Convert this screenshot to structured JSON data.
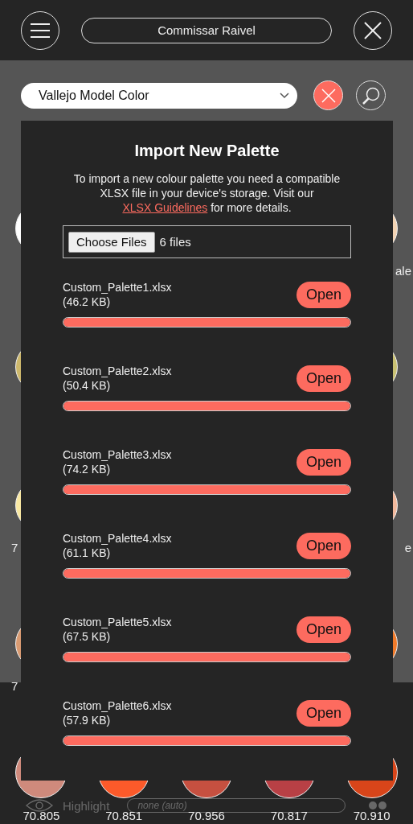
{
  "header": {
    "title": "Commissar Raivel"
  },
  "toolbar": {
    "palette": "Vallejo Model Color"
  },
  "swatch_rows": [
    {
      "left": {
        "color": "#ffffff"
      },
      "right": {
        "color": "#f3d3b3",
        "label": "ale"
      }
    },
    {
      "left": {
        "color": "#cdb86c"
      },
      "right": {
        "color": "#c9c173"
      }
    },
    {
      "left": {
        "color": "#f9e8a2",
        "label": "7"
      },
      "right": {
        "color": "#f1b89c",
        "label": "e"
      }
    },
    {
      "left": {
        "color": "#d99b72",
        "label": "7"
      },
      "right": {
        "color": "#f07a2a"
      }
    }
  ],
  "dialog": {
    "title": "Import New Palette",
    "text": "To import a new colour palette you need a compatible XLSX file in your device's storage. Visit our",
    "link": "XLSX Guidelines",
    "text_end": "for more details.",
    "choose_button": "Choose Files",
    "chosen": "6 files",
    "files": [
      {
        "name": "Custom_Palette1.xlsx",
        "size": "(46.2 KB)",
        "button": "Open",
        "level": 1
      },
      {
        "name": "Custom_Palette2.xlsx",
        "size": "(50.4 KB)",
        "button": "Open",
        "level": 1
      },
      {
        "name": "Custom_Palette3.xlsx",
        "size": "(74.2 KB)",
        "button": "Open",
        "level": 1
      },
      {
        "name": "Custom_Palette4.xlsx",
        "size": "(61.1 KB)",
        "button": "Open",
        "level": 1
      },
      {
        "name": "Custom_Palette5.xlsx",
        "size": "(67.5 KB)",
        "button": "Open",
        "level": 1
      },
      {
        "name": "Custom_Palette6.xlsx",
        "size": "(57.9 KB)",
        "button": "Open",
        "level": 1
      }
    ]
  },
  "bottom_swatches": [
    {
      "color": "#cf8a7c",
      "code": "70.805"
    },
    {
      "color": "#fc5a2a",
      "code": "70.851"
    },
    {
      "color": "#c65040",
      "code": "70.956"
    },
    {
      "color": "#b84045",
      "code": "70.817"
    },
    {
      "color": "#d8451a",
      "code": "70.910"
    }
  ],
  "highlight": {
    "label": "Highlight",
    "placeholder": "none (auto)"
  }
}
